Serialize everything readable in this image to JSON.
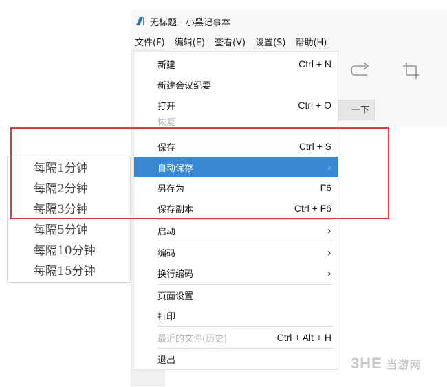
{
  "window": {
    "title": "无标题 - 小黑记事本"
  },
  "menubar": [
    "文件(F)",
    "编辑(E)",
    "查看(V)",
    "设置(S)",
    "帮助(H)"
  ],
  "toolbar": {
    "partial_button_text": "一下"
  },
  "file_menu": {
    "new": {
      "label": "新建",
      "shortcut": "Ctrl + N"
    },
    "new_meeting": {
      "label": "新建会议纪要"
    },
    "open": {
      "label": "打开",
      "shortcut": "Ctrl + O"
    },
    "restore": {
      "label": "恢复"
    },
    "save": {
      "label": "保存",
      "shortcut": "Ctrl + S"
    },
    "auto_save": {
      "label": "自动保存"
    },
    "save_as": {
      "label": "另存为",
      "shortcut": "F6"
    },
    "save_copy": {
      "label": "保存副本",
      "shortcut": "Ctrl + F6"
    },
    "startup": {
      "label": "启动"
    },
    "encoding": {
      "label": "编码"
    },
    "line_ending": {
      "label": "换行编码"
    },
    "page_setup": {
      "label": "页面设置"
    },
    "print": {
      "label": "打印"
    },
    "recent": {
      "label": "最近的文件(历史)",
      "shortcut": "Ctrl + Alt + H"
    },
    "exit": {
      "label": "退出"
    }
  },
  "auto_save_submenu": [
    "每隔1分钟",
    "每隔2分钟",
    "每隔3分钟",
    "每隔5分钟",
    "每隔10分钟",
    "每隔15分钟"
  ],
  "watermark": {
    "logo": "3HE",
    "text": "当游网"
  },
  "colors": {
    "highlight": "#3a87d3",
    "red_box": "#e2393c"
  }
}
